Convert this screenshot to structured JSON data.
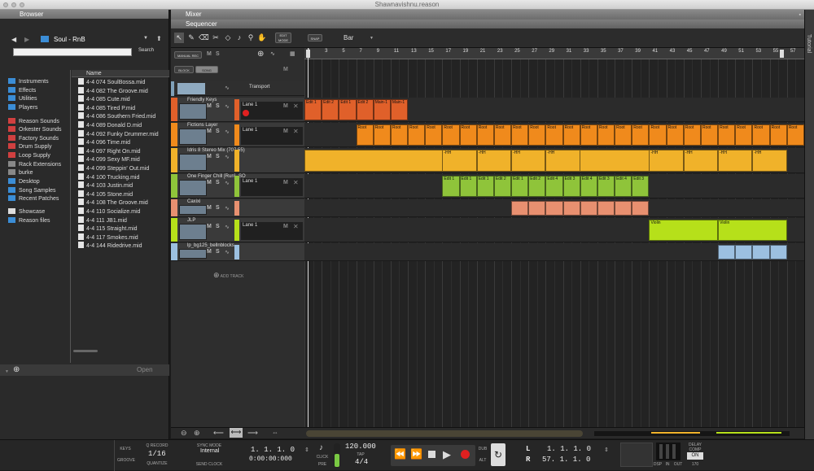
{
  "window": {
    "title": "Shawnavishnu.reason"
  },
  "browser": {
    "title": "Browser",
    "folder": "Soul - RnB",
    "search_label": "Search",
    "col_name": "Name",
    "footer_open": "Open",
    "categories": [
      {
        "label": "Instruments",
        "color": "#3b8dd6"
      },
      {
        "label": "Effects",
        "color": "#3b8dd6"
      },
      {
        "label": "Utilities",
        "color": "#3b8dd6"
      },
      {
        "label": "Players",
        "color": "#3b8dd6"
      },
      {
        "label": "Reason Sounds",
        "color": "#d04040"
      },
      {
        "label": "Orkester Sounds",
        "color": "#d04040"
      },
      {
        "label": "Factory Sounds",
        "color": "#d04040"
      },
      {
        "label": "Drum Supply",
        "color": "#d04040"
      },
      {
        "label": "Loop Supply",
        "color": "#d04040"
      },
      {
        "label": "Rack Extensions",
        "color": "#888888"
      },
      {
        "label": "burke",
        "color": "#888888"
      },
      {
        "label": "Desktop",
        "color": "#3b8dd6"
      },
      {
        "label": "Song Samples",
        "color": "#3b8dd6"
      },
      {
        "label": "Recent Patches",
        "color": "#3b8dd6"
      },
      {
        "label": "Showcase",
        "color": "#dddddd"
      },
      {
        "label": "Reason files",
        "color": "#3b8dd6"
      }
    ],
    "files": [
      "4-4 074 SoulBossa.mid",
      "4-4 082 The Groove.mid",
      "4-4 085 Cute.mid",
      "4-4 085 Tired P.mid",
      "4-4 086 Southern Fried.mid",
      "4-4 089 Donald D.mid",
      "4-4 092 Funky Drummer.mid",
      "4-4 096 Time.mid",
      "4-4 097 Right On.mid",
      "4-4 099 Sexy MF.mid",
      "4-4 099 Steppin' Out.mid",
      "4-4 100 Trucking.mid",
      "4-4 103 Justin.mid",
      "4-4 105 Stone.mid",
      "4-4 108 The Groove.mid",
      "4-4 110 Socialize.mid",
      "4-4 111 JB1.mid",
      "4-4 115 Straight.mid",
      "4-4 117 Smokes.mid",
      "4-4 144 Ridedrive.mid"
    ]
  },
  "mixer": {
    "title": "Mixer"
  },
  "sequencer": {
    "title": "Sequencer",
    "edit_mode": "EDIT MODE",
    "snap": "SNAP",
    "snap_value": "Bar",
    "manual_rec": "MANUAL REC",
    "block": "BLOCK",
    "song": "SONG",
    "m": "M",
    "s": "S",
    "transport_track": "Transport",
    "add_track": "ADD TRACK",
    "ruler": [
      "1",
      "3",
      "5",
      "7",
      "9",
      "11",
      "13",
      "15",
      "17",
      "19",
      "21",
      "23",
      "25",
      "27",
      "29",
      "31",
      "33",
      "35",
      "37",
      "39",
      "41",
      "43",
      "45",
      "47",
      "49",
      "51",
      "53",
      "55",
      "57"
    ],
    "loop_end": "L",
    "tracks": [
      {
        "name": "Friendly Keys",
        "lane": "Lane 1",
        "color": "#e0602a"
      },
      {
        "name": "Fictions Layer",
        "lane": "Lane 1",
        "color": "#f08a1c"
      },
      {
        "name": "Idris 8   Stereo Mix   (707 55)",
        "lane": "",
        "color": "#f0b22a"
      },
      {
        "name": "One Finger Chill  [Run]  -SO",
        "lane": "Lane 1",
        "color": "#8fc43a"
      },
      {
        "name": "Caxixi",
        "lane": "",
        "color": "#e89070"
      },
      {
        "name": "JLP",
        "lane": "Lane 1",
        "color": "#b6e01a"
      },
      {
        "name": "lp_bg125_bellnblocks",
        "lane": "",
        "color": "#9cc0e0"
      }
    ],
    "clips": {
      "keys": [
        "Edit 1",
        "Edit 2",
        "Edit 1",
        "Edit 2",
        "Main-1",
        "Main-1"
      ],
      "fictions": [
        "Root",
        "Root",
        "Root",
        "Root",
        "Root",
        "Root",
        "Root",
        "Root",
        "Root",
        "Root",
        "Root",
        "Root",
        "Root",
        "Root",
        "Root",
        "Root",
        "Root",
        "Root",
        "Root",
        "Root",
        "Root",
        "Root",
        "Root",
        "Root",
        "Root",
        "Root"
      ],
      "idris": [
        "-HH",
        "-HH",
        "-HH",
        "-HH",
        "-HH",
        "-HH",
        "-HH",
        "-HH"
      ],
      "chill": [
        "Edit 1",
        "Edit 1",
        "Edit 1",
        "Edit 2",
        "Edit 1",
        "Edit 2",
        "Edit 4",
        "Edit 3",
        "Edit 4",
        "Edit 3",
        "Edit 4",
        "Edit 3"
      ],
      "violin": [
        "Violin",
        "Violin"
      ]
    }
  },
  "transport": {
    "keys": "KEYS",
    "groove": "GROOVE",
    "qrecord": "Q RECORD",
    "quantize_value": "1/16",
    "quantize": "QUANTIZE",
    "sync_mode": "SYNC MODE",
    "sync_value": "Internal",
    "send_clock": "SEND CLOCK",
    "position": "1.   1.   1.     0",
    "time": "0:00:00:000",
    "click": "CLICK",
    "pre": "PRE",
    "tempo": "120.000",
    "tap": "TAP",
    "signature": "4/4",
    "dub": "DUB",
    "alt": "ALT",
    "l_label": "L",
    "r_label": "R",
    "l_pos": "1.   1.   1.     0",
    "r_pos": "57.   1.   1.     0",
    "dsp": "DSP",
    "in": "IN",
    "out": "OUT",
    "delay_comp": "DELAY COMP",
    "on": "ON",
    "delay_val": "170"
  },
  "tutorial": "Tutorial"
}
